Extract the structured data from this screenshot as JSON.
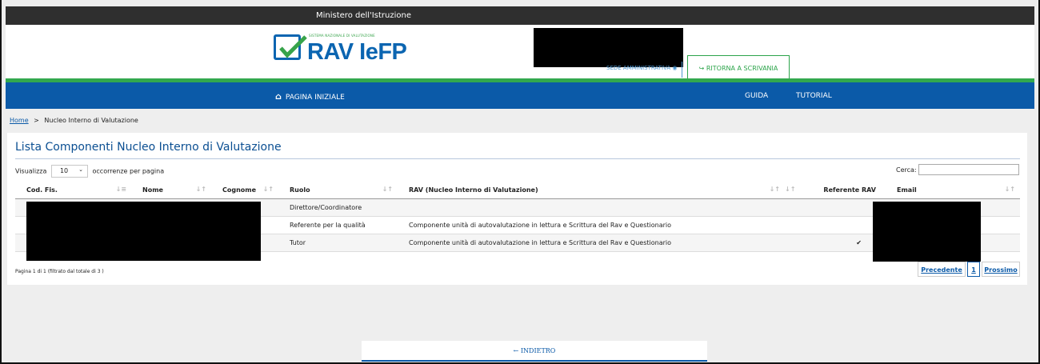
{
  "topbar": {
    "title": "Ministero dell'Istruzione"
  },
  "header": {
    "logo_small": "SISTEMA NAZIONALE DI VALUTAZIONE",
    "logo_big": "RAV IeFP",
    "sede": "SEDE AMMINISTRATIVA ◉",
    "ritorna_icon": "↪",
    "ritorna_label": "RITORNA A SCRIVANIA"
  },
  "nav": {
    "home_icon": "⌂",
    "home_label": "PAGINA INIZIALE",
    "guida": "GUIDA",
    "tutorial": "TUTORIAL"
  },
  "breadcrumb": {
    "home": "Home",
    "sep": ">",
    "current": "Nucleo Interno di Valutazione"
  },
  "main": {
    "title": "Lista Componenti Nucleo Interno di Valutazione",
    "length_label_pre": "Visualizza",
    "length_value": "10",
    "length_label_post": "occorrenze per pagina",
    "search_label": "Cerca:",
    "search_value": "",
    "columns": [
      "Cod. Fis.",
      "Nome",
      "Cognome",
      "Ruolo",
      "RAV (Nucleo Interno di Valutazione)",
      "Referente RAV",
      "Email"
    ],
    "rows": [
      {
        "cf": "",
        "nome": "",
        "cognome": "",
        "ruolo": "Direttore/Coordinatore",
        "rav": "",
        "referente": "",
        "email": ""
      },
      {
        "cf": "",
        "nome": "",
        "cognome": "",
        "ruolo": "Referente per la qualità",
        "rav": "Componente unità di autovalutazione in lettura e Scrittura del Rav e Questionario",
        "referente": "",
        "email": ""
      },
      {
        "cf": "",
        "nome": "",
        "cognome": "",
        "ruolo": "Tutor",
        "rav": "Componente unità di autovalutazione in lettura e Scrittura del Rav e Questionario",
        "referente": "✔",
        "email": ""
      }
    ],
    "info": "Pagina 1 di 1 (filtrato dal totale di 3 )",
    "pager": {
      "prev": "Precedente",
      "current": "1",
      "next": "Prossimo"
    }
  },
  "footer": {
    "back_icon": "←",
    "back_label": "INDIETRO"
  },
  "colors": {
    "brand_blue": "#0b5aa8",
    "green": "#32a84e",
    "topbar": "#2f2f2f"
  }
}
